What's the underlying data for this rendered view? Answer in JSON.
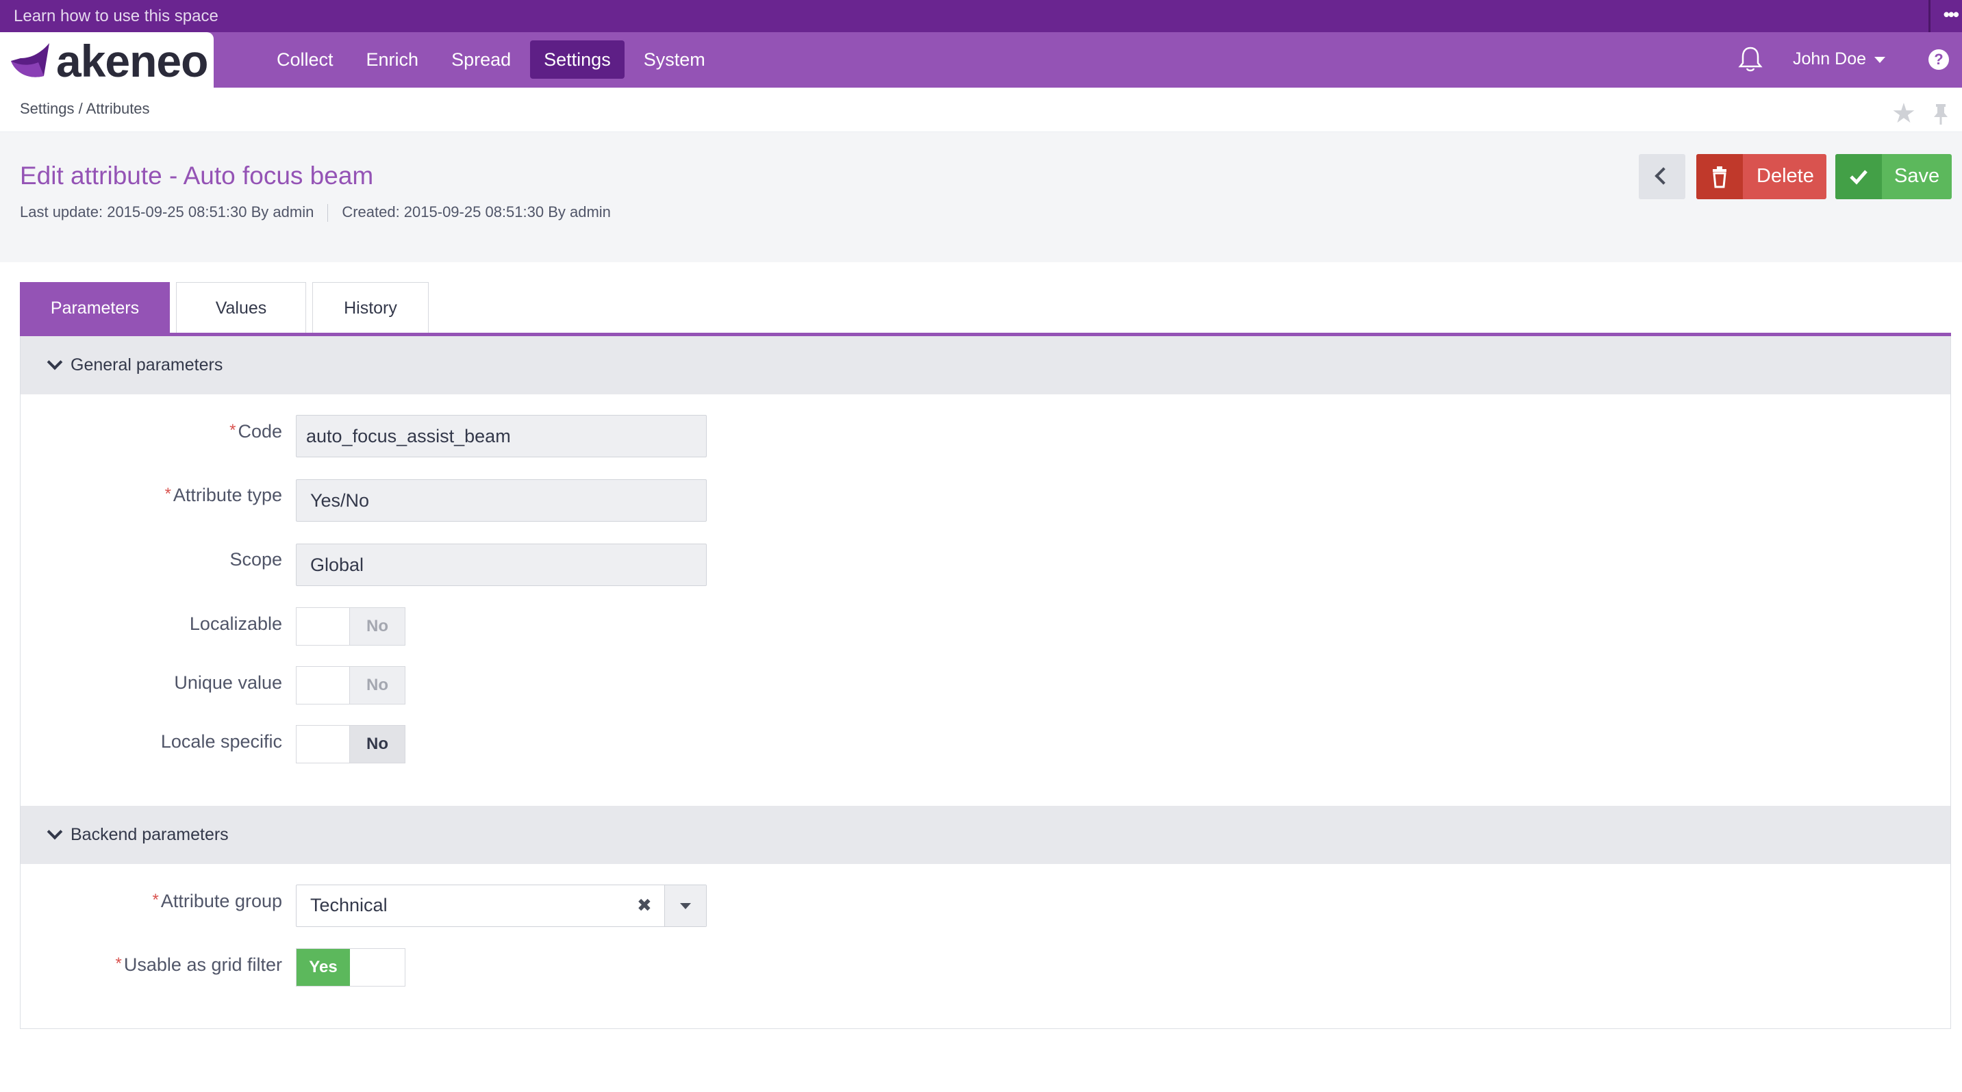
{
  "top_strip": {
    "learn_text": "Learn how to use this space",
    "more_icon": "ellipsis-icon"
  },
  "brand": {
    "logo_text": "akeneo"
  },
  "nav": {
    "items": [
      {
        "label": "Collect",
        "active": false
      },
      {
        "label": "Enrich",
        "active": false
      },
      {
        "label": "Spread",
        "active": false
      },
      {
        "label": "Settings",
        "active": true
      },
      {
        "label": "System",
        "active": false
      }
    ],
    "user_name": "John Doe",
    "help_glyph": "?"
  },
  "breadcrumb": {
    "text": "Settings / Attributes"
  },
  "header": {
    "title": "Edit attribute - Auto focus beam",
    "last_update": "Last update: 2015-09-25 08:51:30 By admin",
    "created": "Created: 2015-09-25 08:51:30 By admin",
    "delete_label": "Delete",
    "save_label": "Save"
  },
  "tabs": [
    {
      "label": "Parameters",
      "active": true
    },
    {
      "label": "Values",
      "active": false
    },
    {
      "label": "History",
      "active": false
    }
  ],
  "general": {
    "title": "General parameters",
    "code_label": "Code",
    "code_value": "auto_focus_assist_beam",
    "type_label": "Attribute type",
    "type_value": "Yes/No",
    "scope_label": "Scope",
    "scope_value": "Global",
    "localizable_label": "Localizable",
    "localizable_value": "No",
    "unique_label": "Unique value",
    "unique_value": "No",
    "locale_specific_label": "Locale specific",
    "locale_specific_value": "No"
  },
  "backend": {
    "title": "Backend parameters",
    "group_label": "Attribute group",
    "group_value": "Technical",
    "clear_glyph": "✖",
    "grid_filter_label": "Usable as grid filter",
    "grid_filter_value": "Yes"
  },
  "required_marker": "*",
  "colors": {
    "brand": "#9453b5",
    "brand_dark": "#6a2590",
    "delete": "#d9534f",
    "save": "#5cb85c"
  }
}
